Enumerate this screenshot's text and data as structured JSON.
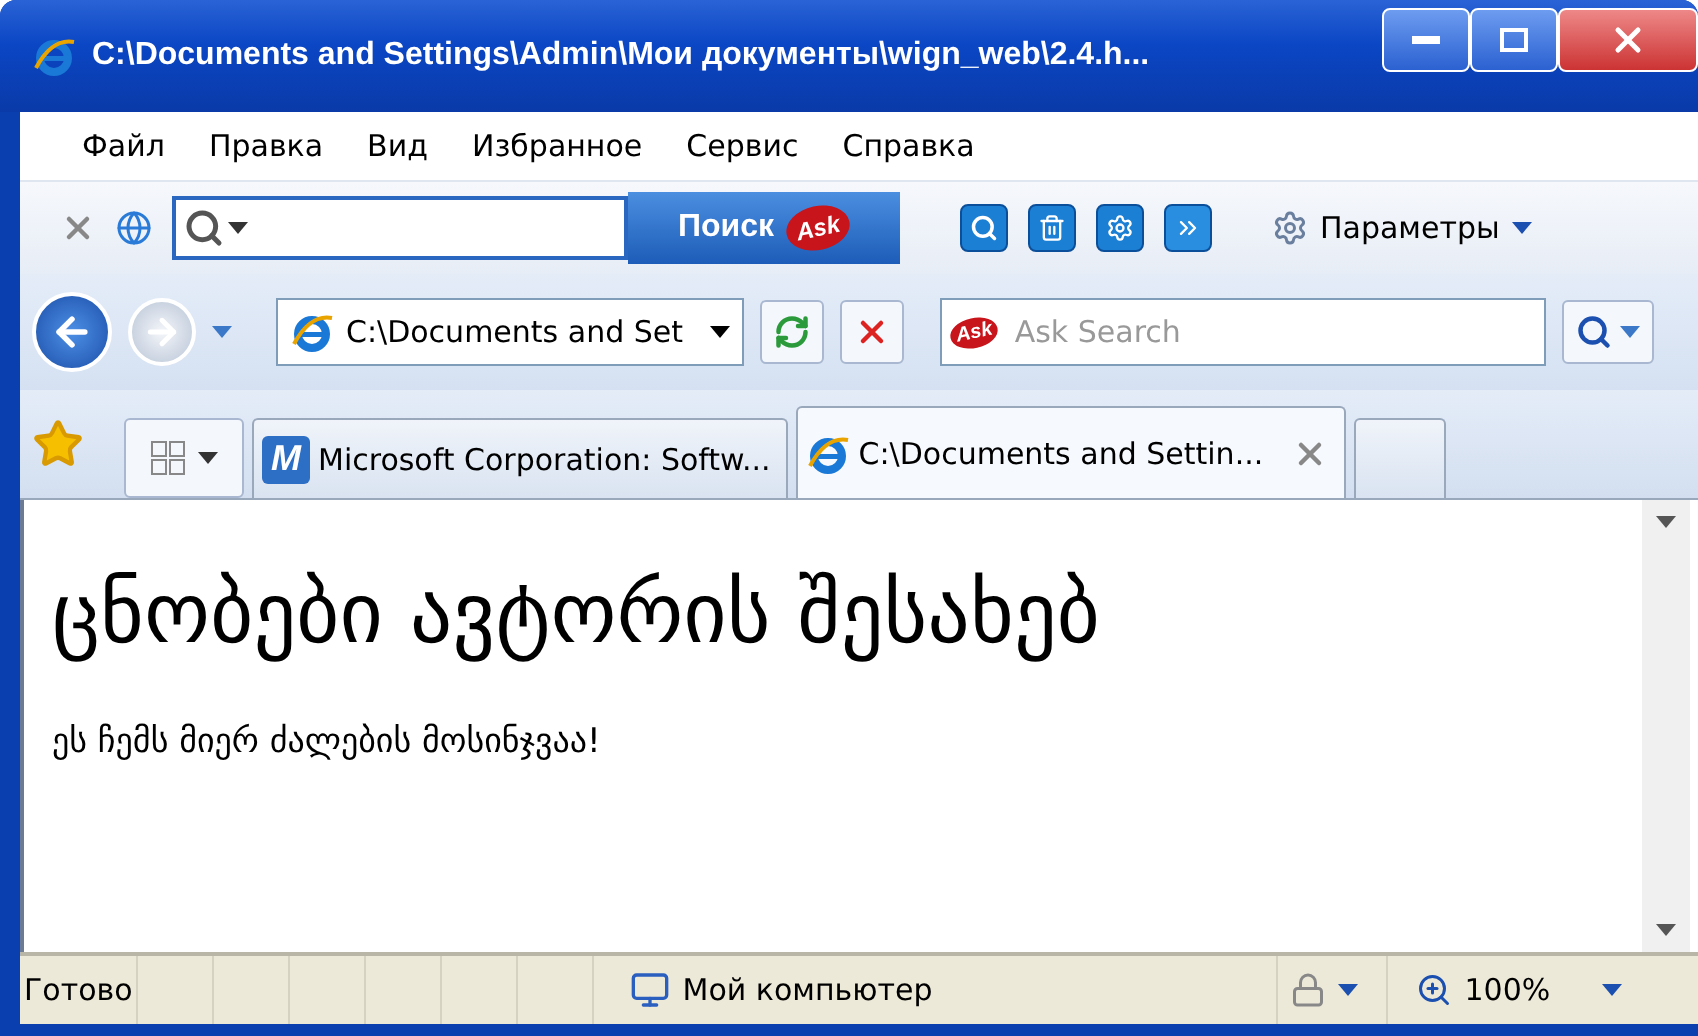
{
  "window": {
    "title": "C:\\Documents and Settings\\Admin\\Мои документы\\wign_web\\2.4.h..."
  },
  "menu": [
    "Файл",
    "Правка",
    "Вид",
    "Избранное",
    "Сервис",
    "Справка"
  ],
  "ask_toolbar": {
    "search_button": "Поиск",
    "logo": "Ask",
    "options": "Параметры"
  },
  "address_bar": {
    "value": "C:\\Documents and Set"
  },
  "search_box": {
    "placeholder": "Ask Search",
    "logo": "Ask"
  },
  "tabs": [
    {
      "label": "Microsoft Corporation: Softw...",
      "selected": false,
      "icon_letter": "M"
    },
    {
      "label": "C:\\Documents and Settin...",
      "selected": true
    }
  ],
  "page": {
    "heading": "ცნობები ავტორის შესახებ",
    "paragraph": "ეს ჩემს მიერ ძალების მოსინჯვაა!"
  },
  "status_bar": {
    "status": "Готово",
    "zone": "Мой компьютер",
    "zoom": "100%"
  }
}
